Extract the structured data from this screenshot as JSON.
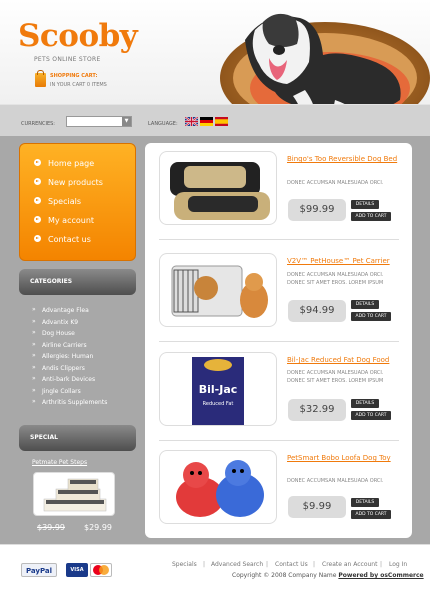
{
  "header": {
    "logo": "Scooby",
    "tagline": "PETS ONLINE STORE",
    "cart_title": "SHOPPING CART:",
    "cart_sub": "IN YOUR CART 0 ITEMS",
    "currencies_label": "CURRENCIES:",
    "currency_value": "",
    "language_label": "LANGUAGE:"
  },
  "menu": [
    "Home page",
    "New products",
    "Specials",
    "My account",
    "Contact us"
  ],
  "categories": {
    "title": "CATEGORIES",
    "items": [
      "Advantage Flea",
      "Advantix K9",
      "Dog House",
      "Airline Carriers",
      "Allergies: Human",
      "Andis Clippers",
      "Anti-bark Devices",
      "Jingle Collars",
      "Arthritis Supplements"
    ]
  },
  "special": {
    "title": "SPECIAL",
    "link": "Petmate Pet Steps",
    "old_price": "$39.99",
    "new_price": "$29.99"
  },
  "products": [
    {
      "title": "Bingo's Too Reversible Dog Bed",
      "desc1": "DONEC ACCUMSAN MALESUADA ORCI.",
      "desc2": "",
      "price": "$99.99",
      "details": "DETAILS",
      "add": "ADD TO CART"
    },
    {
      "title": "V2V™ PetHouse™ Pet Carrier",
      "desc1": "DONEC ACCUMSAN MALESUADA ORCI.",
      "desc2": "DONEC SIT AMET EROS. LOREM IPSUM",
      "price": "$94.99",
      "details": "DETAILS",
      "add": "ADD TO CART"
    },
    {
      "title": "Bil-Jac Reduced Fat Dog Food",
      "desc1": "DONEC ACCUMSAN MALESUADA ORCI.",
      "desc2": "DONEC SIT AMET EROS. LOREM IPSUM",
      "price": "$32.99",
      "details": "DETAILS",
      "add": "ADD TO CART"
    },
    {
      "title": "PetSmart Bobo Loofa Dog Toy",
      "desc1": "DONEC ACCUMSAN MALESUADA ORCI.",
      "desc2": "",
      "price": "$9.99",
      "details": "DETAILS",
      "add": "ADD TO CART"
    }
  ],
  "footer": {
    "links": [
      "Specials",
      "Advanced Search",
      "Contact Us",
      "Create an Account",
      "Log In"
    ],
    "copyright": "Copyright © 2008 Company Name",
    "powered": "Powered by osCommerce",
    "paypal": "PayPal",
    "visa": "VISA",
    "mastercard": "MasterCard"
  },
  "colors": {
    "accent": "#f07a0c",
    "menu": "#f48400",
    "panel": "#a8a8a8"
  }
}
